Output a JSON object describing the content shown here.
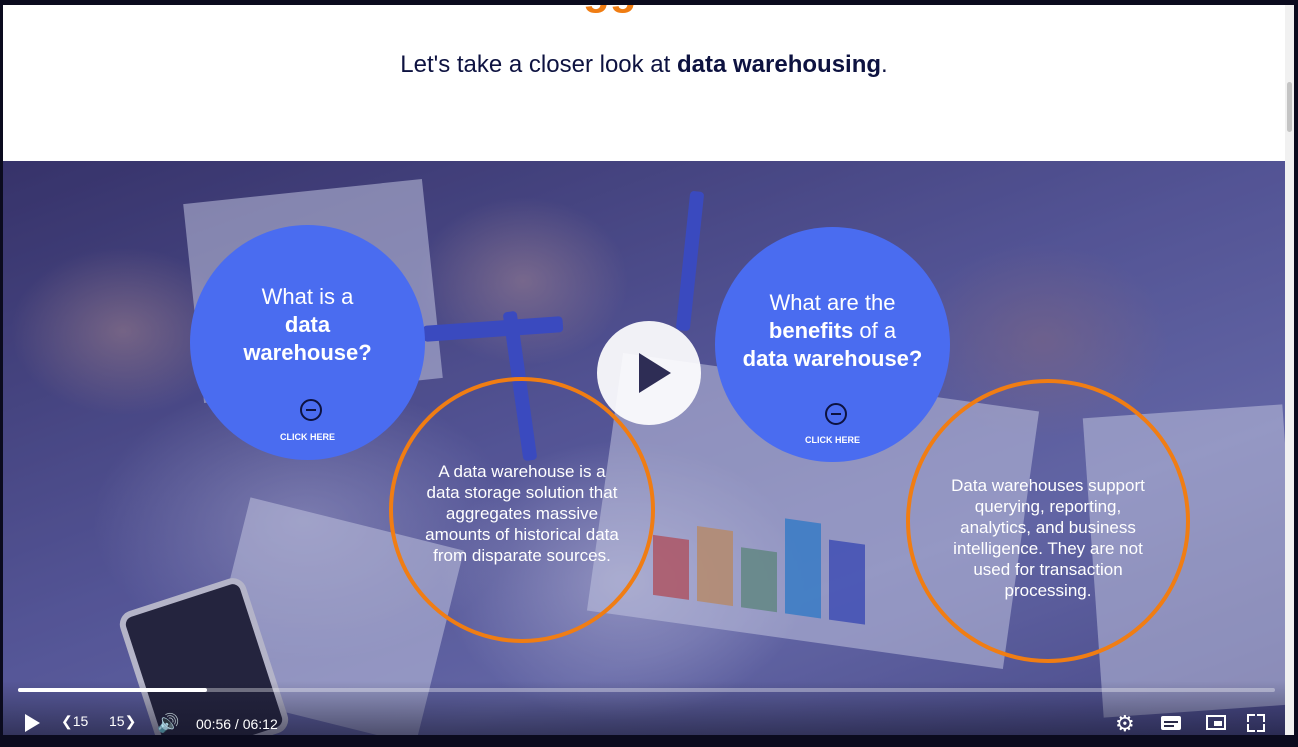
{
  "header": {
    "title": "The Bigger Picture",
    "subtitle_prefix": "Let's take a closer look at ",
    "subtitle_bold": "data warehousing",
    "subtitle_suffix": "."
  },
  "cards": [
    {
      "question_line1": "What is a",
      "question_bold1": "data",
      "question_bold2": "warehouse?",
      "click_label": "CLICK HERE",
      "answer": "A data warehouse is a data storage solution that aggregates massive amounts of historical data from disparate sources."
    },
    {
      "question_line1": "What are the",
      "question_bold_inline": "benefits",
      "question_line2_suffix": " of a",
      "question_bold2": "data warehouse?",
      "click_label": "CLICK HERE",
      "answer": "Data warehouses support querying, reporting, analytics, and business intelligence. They are not used for transaction processing."
    }
  ],
  "player": {
    "rewind_label": "15",
    "forward_label": "15",
    "time": "00:56 / 06:12",
    "progress_fraction": 0.15
  },
  "colors": {
    "accent_orange": "#f07d13",
    "circle_blue": "#4a6cf0",
    "title_navy": "#0d1240"
  },
  "icons": [
    "play-icon",
    "rewind-15-icon",
    "forward-15-icon",
    "volume-icon",
    "gear-icon",
    "captions-icon",
    "pip-icon",
    "fullscreen-icon",
    "minus-circle-icon",
    "big-play-icon"
  ]
}
